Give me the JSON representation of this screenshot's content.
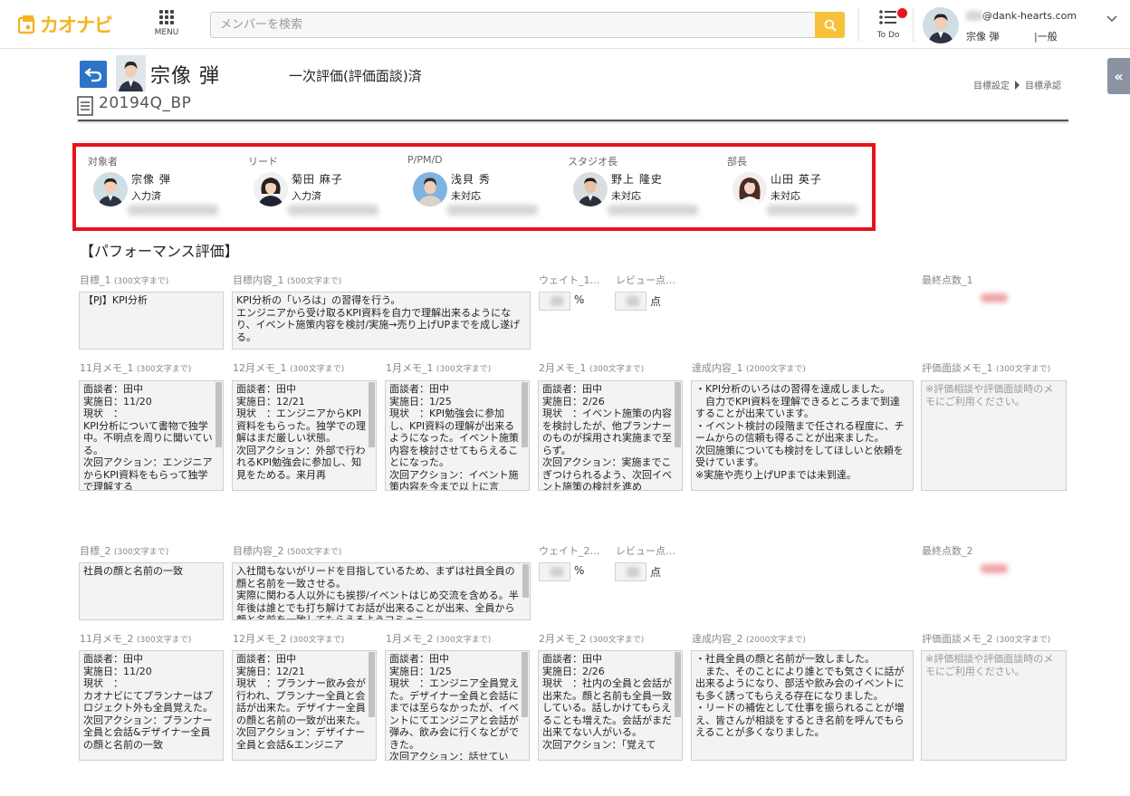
{
  "header": {
    "logo_text": "カオナビ",
    "menu_label": "MENU",
    "search_placeholder": "メンバーを検索",
    "todo_label": "To Do",
    "user_email_domain": "@dank-hearts.com",
    "user_name": "宗像 弾",
    "user_role": "|一般",
    "accent_color": "#f7c23a",
    "badge_color": "#e8151d"
  },
  "title": {
    "name": "宗像 弾",
    "status": "一次評価(評価面談)済",
    "period": "20194Q_BP",
    "breadcrumb": [
      "目標設定",
      "目標承認"
    ]
  },
  "approvers": [
    {
      "role": "対象者",
      "name": "宗像 弾",
      "status": "入力済"
    },
    {
      "role": "リード",
      "name": "菊田 麻子",
      "status": "入力済"
    },
    {
      "role": "P/PM/D",
      "name": "浅貝 秀",
      "status": "未対応"
    },
    {
      "role": "スタジオ長",
      "name": "野上 隆史",
      "status": "未対応"
    },
    {
      "role": "部長",
      "name": "山田 英子",
      "status": "未対応"
    }
  ],
  "section_title": "【パフォーマンス評価】",
  "labels": {
    "limit300": "(300文字まで)",
    "limit500": "(500文字まで)",
    "limit2000": "(2000文字まで)",
    "pct": "%",
    "pts": "点"
  },
  "goals": [
    {
      "goal_label": "目標_1",
      "content_label": "目標内容_1",
      "weight_label": "ウェイト_1…",
      "review_label": "レビュー点…",
      "final_label": "最終点数_1",
      "goal": "【PJ】KPI分析",
      "content": "KPI分析の「いろは」の習得を行う。\nエンジニアから受け取るKPI資料を自力で理解出来るようになり、イベント施策内容を検討/実施→売り上げUPまでを成し遂げる。",
      "memo_labels": [
        "11月メモ_1",
        "12月メモ_1",
        "1月メモ_1",
        "2月メモ_1"
      ],
      "achieve_label": "達成内容_1",
      "interview_label": "評価面談メモ_1",
      "memos": [
        "面談者：田中\n実施日：11/20\n現状　：\nKPI分析について書物で独学中。不明点を周りに聞いている。\n次回アクション：エンジニアからKPI資料をもらって独学で理解する",
        "面談者：田中\n実施日：12/21\n現状　：エンジニアからKPI資料をもらった。独学での理解はまだ厳しい状態。\n次回アクション：外部で行われるKPI勉強会に参加し、知見をためる。来月再",
        "面談者：田中\n実施日：1/25\n現状　：KPI勉強会に参加し、KPI資料の理解が出来るようになった。イベント施策内容を検討させてもらえることになった。\n次回アクション：イベント施策内容を今まで以上に言",
        "面談者：田中\n実施日：2/26\n現状　：イベント施策の内容を検討したが、他プランナーのものが採用され実施まで至らず。\n次回アクション：実施までこぎつけられるよう、次回イベント施策の検討を進め"
      ],
      "achieve": "・KPI分析のいろはの習得を達成しました。\n　自力でKPI資料を理解できるところまで到達することが出来ています。\n・イベント検討の段階まで任される程度に、チームからの信頼も得ることが出来ました。\n次回施策についても検討をしてほしいと依頼を受けています。\n※実施や売り上げUPまでは未到達。",
      "interview": "※評価相談や評価面談時のメモにご利用ください。"
    },
    {
      "goal_label": "目標_2",
      "content_label": "目標内容_2",
      "weight_label": "ウェイト_2…",
      "review_label": "レビュー点…",
      "final_label": "最終点数_2",
      "goal": "社員の顔と名前の一致",
      "content": "入社間もないがリードを目指しているため、まずは社員全員の顔と名前を一致させる。\n実際に関わる人以外にも挨拶/イベントはじめ交流を含める。半年後は誰とでも打ち解けてお話が出来ることが出来、全員から顔と名前を一致してもらえるようコミュニ",
      "memo_labels": [
        "11月メモ_2",
        "12月メモ_2",
        "1月メモ_2",
        "2月メモ_2"
      ],
      "achieve_label": "達成内容_2",
      "interview_label": "評価面談メモ_2",
      "memos": [
        "面談者：田中\n実施日：11/20\n現状　：\nカオナビにてプランナーはプロジェクト外も全員覚えた。\n次回アクション：プランナー全員と会話&デザイナー全員の顔と名前の一致",
        "面談者：田中\n実施日：12/21\n現状　：プランナー飲み会が行われ、プランナー全員と会話が出来た。デザイナー全員の顔と名前の一致が出来た。\n次回アクション：デザイナー全員と会話&エンジニア",
        "面談者：田中\n実施日：1/25\n現状　：エンジニア全員覚えた。デザイナー全員と会話にまでは至らなかったが、イベントにてエンジニアと会話が弾み、飲み会に行くなどができた。\n次回アクション：話せてい",
        "面談者：田中\n実施日：2/26\n現状　：社内の全員と会話が出来た。顔と名前も全員一致している。話しかけてもらえることも増えた。会話がまだ出来てない人がいる。\n次回アクション：「覚えて"
      ],
      "achieve": "・社員全員の顔と名前が一致しました。\n　また、そのことにより誰とでも気さくに話が出来るようになり、部活や飲み会のイベントにも多く誘ってもらえる存在になりました。\n・リードの補佐として仕事を振られることが増え、皆さんが相談をするとき名前を呼んでもらえることが多くなりました。",
      "interview": "※評価相談や評価面談時のメモにご利用ください。"
    }
  ]
}
